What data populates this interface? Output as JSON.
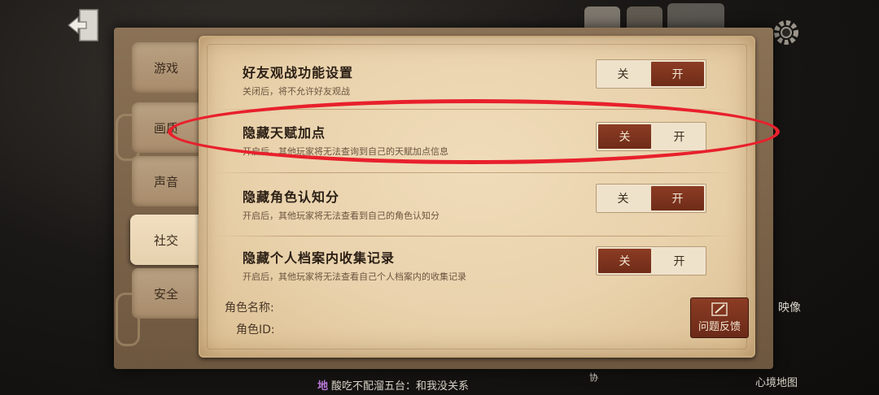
{
  "header": {
    "exit_icon": "exit-door-icon",
    "settings_icon": "gear-icon"
  },
  "tabs": [
    {
      "label": "游戏",
      "active": false
    },
    {
      "label": "画质",
      "active": false
    },
    {
      "label": "声音",
      "active": false
    },
    {
      "label": "社交",
      "active": true
    },
    {
      "label": "安全",
      "active": false
    }
  ],
  "settings": [
    {
      "title": "好友观战功能设置",
      "desc": "关闭后，将不允许好友观战",
      "off_label": "关",
      "on_label": "开",
      "value": "开"
    },
    {
      "title": "隐藏天赋加点",
      "desc": "开启后，其他玩家将无法查询到自己的天赋加点信息",
      "off_label": "关",
      "on_label": "开",
      "value": "关"
    },
    {
      "title": "隐藏角色认知分",
      "desc": "开启后，其他玩家将无法查看到自己的角色认知分",
      "off_label": "关",
      "on_label": "开",
      "value": "开"
    },
    {
      "title": "隐藏个人档案内收集记录",
      "desc": "开启后，其他玩家将无法查看自己个人档案内的收集记录",
      "off_label": "关",
      "on_label": "开",
      "value": "关"
    }
  ],
  "footer": {
    "role_name_label": "角色名称:",
    "role_id_label": "角色ID:",
    "feedback_label": "问题反馈",
    "feedback_icon": "pen-icon"
  },
  "background": {
    "chat_tag": "地",
    "chat_text": "酸吃不配溜五台：和我没关系",
    "right_label_1": "映像",
    "right_label_2": "心境地图",
    "bottom_small": "协"
  },
  "colors": {
    "accent": "#7a3320",
    "highlight_ring": "#e8202c",
    "panel": "#eed8b4"
  }
}
